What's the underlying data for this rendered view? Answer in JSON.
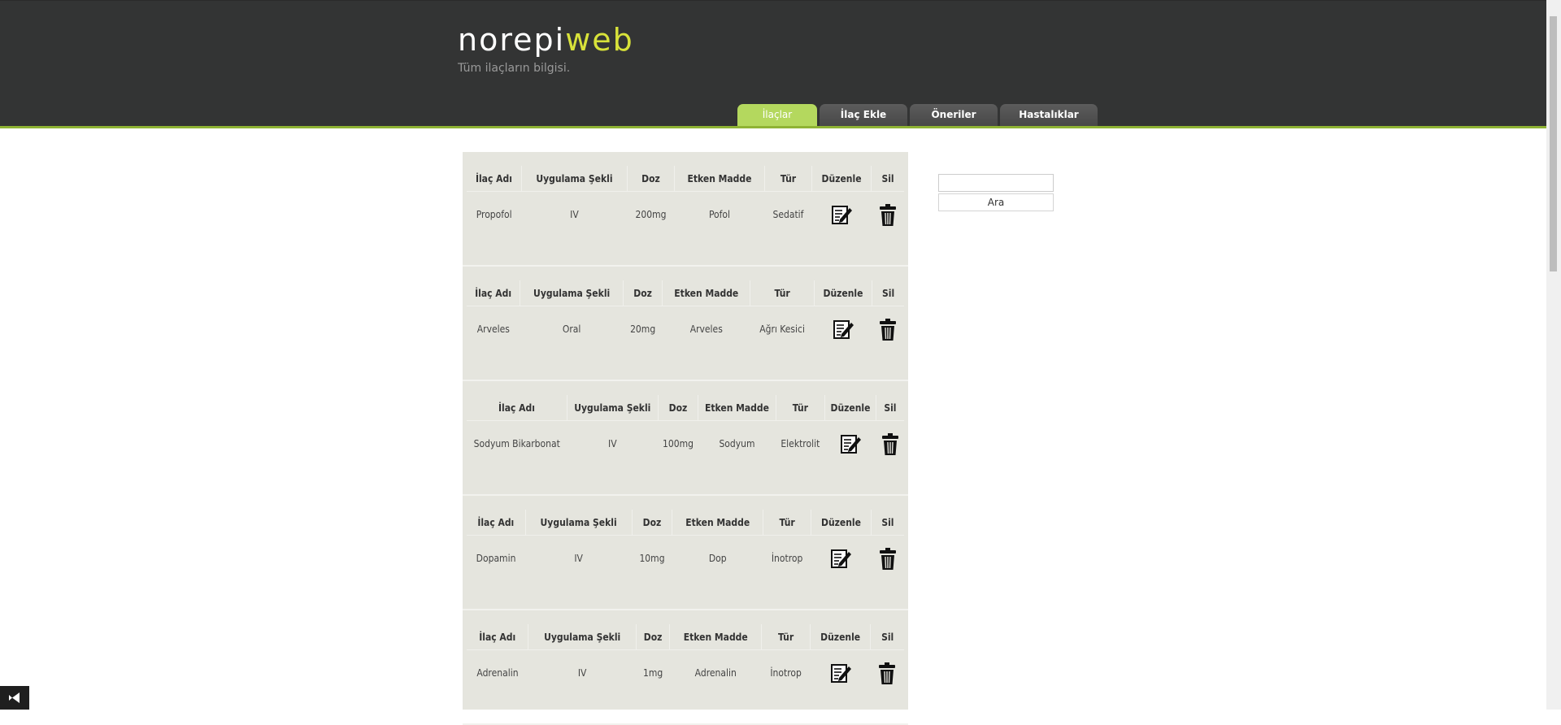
{
  "brand": {
    "part1": "norepi",
    "part2": "web",
    "slogan": "Tüm ilaçların bilgisi."
  },
  "nav": {
    "tabs": [
      {
        "label": "İlaçlar",
        "active": true
      },
      {
        "label": "İlaç Ekle"
      },
      {
        "label": "Öneriler"
      },
      {
        "label": "Hastalıklar"
      }
    ]
  },
  "table_headers": [
    "İlaç Adı",
    "Uygulama Şekli",
    "Doz",
    "Etken Madde",
    "Tür",
    "Düzenle",
    "Sil"
  ],
  "drugs": [
    {
      "name": "Propofol",
      "route": "IV",
      "dose": "200mg",
      "ingredient": "Pofol",
      "type": "Sedatif"
    },
    {
      "name": "Arveles",
      "route": "Oral",
      "dose": "20mg",
      "ingredient": "Arveles",
      "type": "Ağrı Kesici"
    },
    {
      "name": "Sodyum Bikarbonat",
      "route": "IV",
      "dose": "100mg",
      "ingredient": "Sodyum",
      "type": "Elektrolit"
    },
    {
      "name": "Dopamin",
      "route": "IV",
      "dose": "10mg",
      "ingredient": "Dop",
      "type": "İnotrop"
    },
    {
      "name": "Adrenalin",
      "route": "IV",
      "dose": "1mg",
      "ingredient": "Adrenalin",
      "type": "İnotrop"
    }
  ],
  "search": {
    "value": "",
    "button_label": "Ara"
  },
  "icons": {
    "edit": "edit-note-icon",
    "delete": "trash-icon",
    "taskbar": "visual-studio-icon"
  },
  "colors": {
    "header_bg": "#333434",
    "accent": "#b4d85e",
    "brand_accent": "#d8e23a",
    "content_bg": "#e5e5de"
  }
}
